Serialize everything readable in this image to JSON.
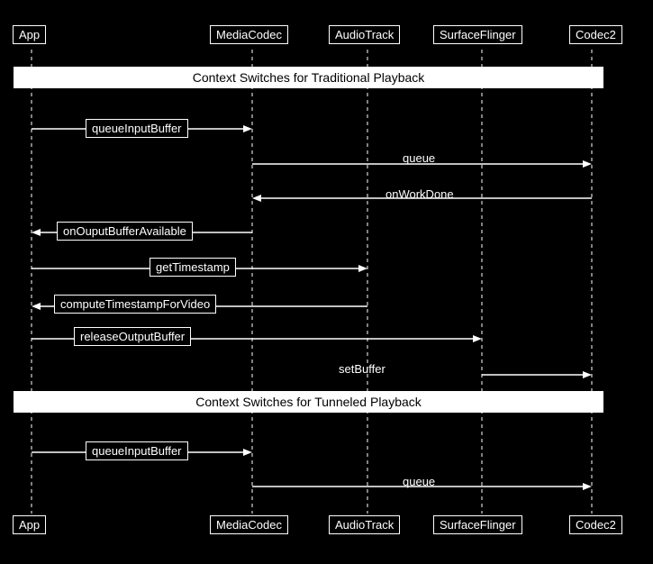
{
  "header": {
    "app": "App",
    "mediacodec": "MediaCodec",
    "audiotrack": "AudioTrack",
    "surfaceflinger": "SurfaceFlinger",
    "codec2": "Codec2"
  },
  "footer": {
    "app": "App",
    "mediacodec": "MediaCodec",
    "audiotrack": "AudioTrack",
    "surfaceflinger": "SurfaceFlinger",
    "codec2": "Codec2"
  },
  "section1": {
    "title": "Context Switches for Traditional Playback"
  },
  "section2": {
    "title": "Context Switches for Tunneled Playback"
  },
  "calls_traditional": [
    {
      "label": "queueInputBuffer",
      "boxed": true
    },
    {
      "label": "queue",
      "boxed": false
    },
    {
      "label": "onWorkDone",
      "boxed": false
    },
    {
      "label": "onOuputBufferAvailable",
      "boxed": true
    },
    {
      "label": "getTimestamp",
      "boxed": true
    },
    {
      "label": "computeTimestampForVideo",
      "boxed": true
    },
    {
      "label": "releaseOutputBuffer",
      "boxed": true
    },
    {
      "label": "setBuffer",
      "boxed": false
    }
  ],
  "calls_tunneled": [
    {
      "label": "queueInputBuffer",
      "boxed": true
    },
    {
      "label": "queue",
      "boxed": false
    }
  ]
}
